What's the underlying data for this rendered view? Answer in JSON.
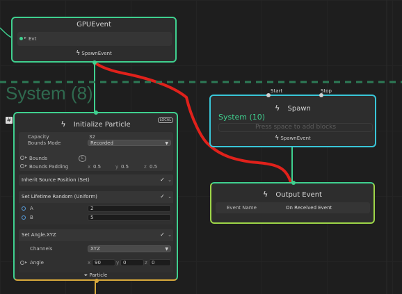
{
  "colors": {
    "green": "#3fd08f",
    "gold": "#d9a93b",
    "cyan": "#39c6d8",
    "red": "#e0211b",
    "lime": "#9ed648"
  },
  "icons": {
    "event": "lightning-icon",
    "plus": "plus-icon"
  },
  "gpu_event": {
    "title": "GPUEvent",
    "input_label": "Evt",
    "output_label": "SpawnEvent"
  },
  "system": {
    "title": "System (8)",
    "tag": "#"
  },
  "init": {
    "title": "Initialize Particle",
    "badge": "LOCAL",
    "capacity_label": "Capacity",
    "capacity_value": "32",
    "bounds_mode_label": "Bounds Mode",
    "bounds_mode_value": "Recorded",
    "bounds_label": "Bounds",
    "bounds_pill": "L",
    "padding_label": "Bounds Padding",
    "padding": {
      "x": "0.5",
      "y": "0.5",
      "z": "0.5"
    },
    "footer_label": "Particle"
  },
  "blocks": {
    "inherit": "Inherit Source Position (Set)",
    "lifetime": "Set Lifetime Random (Uniform)",
    "lifetime_a_label": "A",
    "lifetime_a": "2",
    "lifetime_b_label": "B",
    "lifetime_b": "5",
    "angle_block": "Set Angle.XYZ",
    "channels_label": "Channels",
    "channels_value": "XYZ",
    "angle_label": "Angle",
    "angle": {
      "x": "90",
      "y": "0",
      "z": "0"
    }
  },
  "axes": {
    "x": "x",
    "y": "y",
    "z": "z"
  },
  "check": "✓",
  "spawn": {
    "title": "Spawn",
    "start": "Start",
    "stop": "Stop",
    "system_label": "System (10)",
    "placeholder": "Press space to add blocks",
    "output_label": "SpawnEvent"
  },
  "output_event": {
    "title": "Output Event",
    "name_label": "Event Name",
    "name_value": "On Received Event"
  }
}
